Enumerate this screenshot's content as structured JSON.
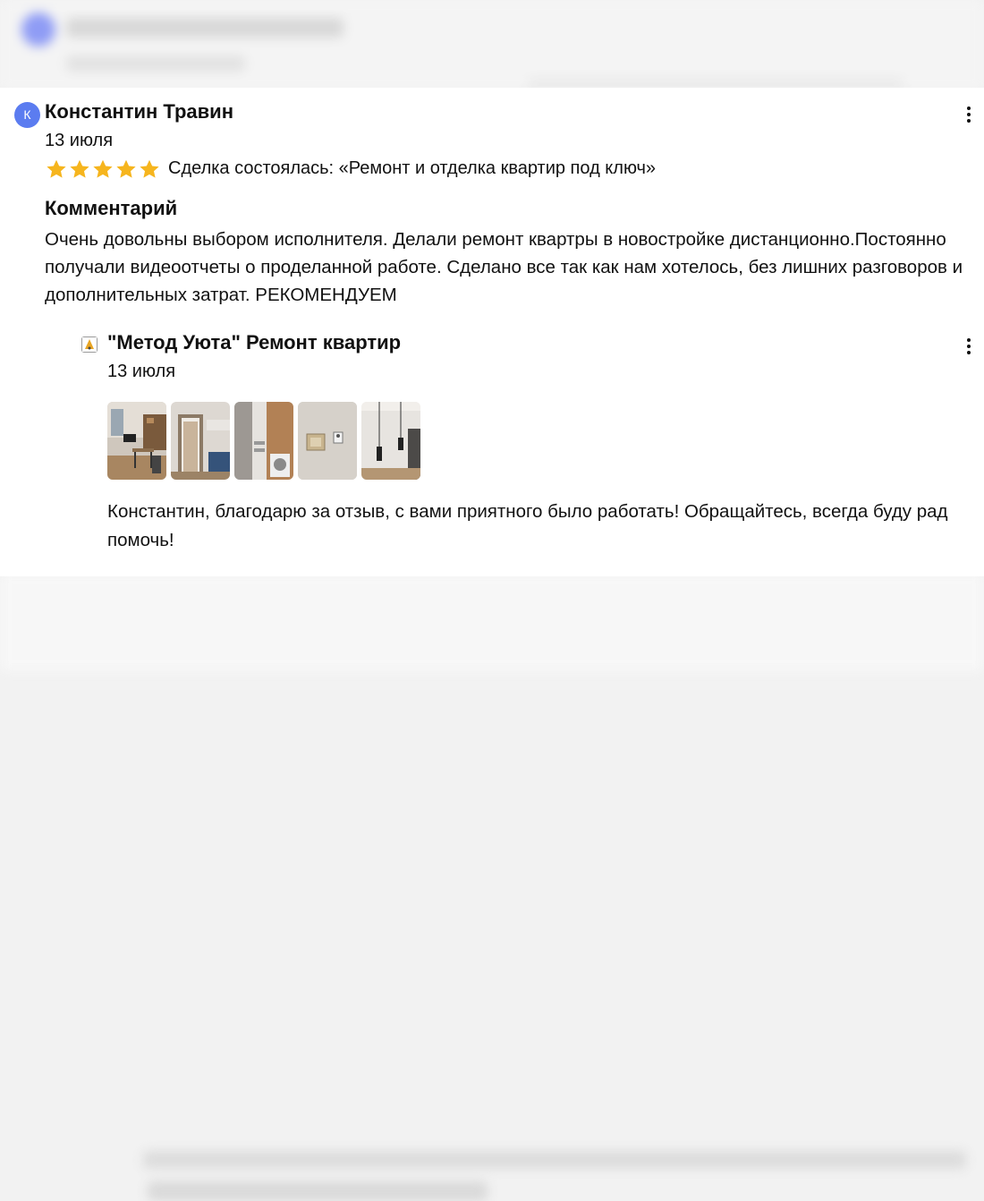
{
  "review": {
    "author_initial": "К",
    "author": "Константин Травин",
    "date": "13 июля",
    "rating": 5,
    "deal_text": "Сделка состоялась: «Ремонт и отделка квартир под ключ»",
    "comment_heading": "Комментарий",
    "comment_text": "Очень довольны выбором исполнителя. Делали ремонт квартры в новостройке дистанционно.Постоянно получали видеоотчеты о проделанной работе. Сделано все так как нам хотелось, без лишних разговоров и дополнительных затрат. РЕКОМЕНДУЕМ"
  },
  "response": {
    "company": "\"Метод Уюта\" Ремонт квартир",
    "date": "13 июля",
    "photos": [
      {
        "icon": "living-room-photo"
      },
      {
        "icon": "doorway-photo"
      },
      {
        "icon": "bathroom-photo"
      },
      {
        "icon": "switch-photo"
      },
      {
        "icon": "pendant-lamps-photo"
      }
    ],
    "text": "Константин, благодарю за отзыв, с вами приятного было работать! Обращайтесь, всегда буду рад помочь!"
  },
  "colors": {
    "avatar": "#5b7cf0",
    "star": "#f6b51e"
  }
}
